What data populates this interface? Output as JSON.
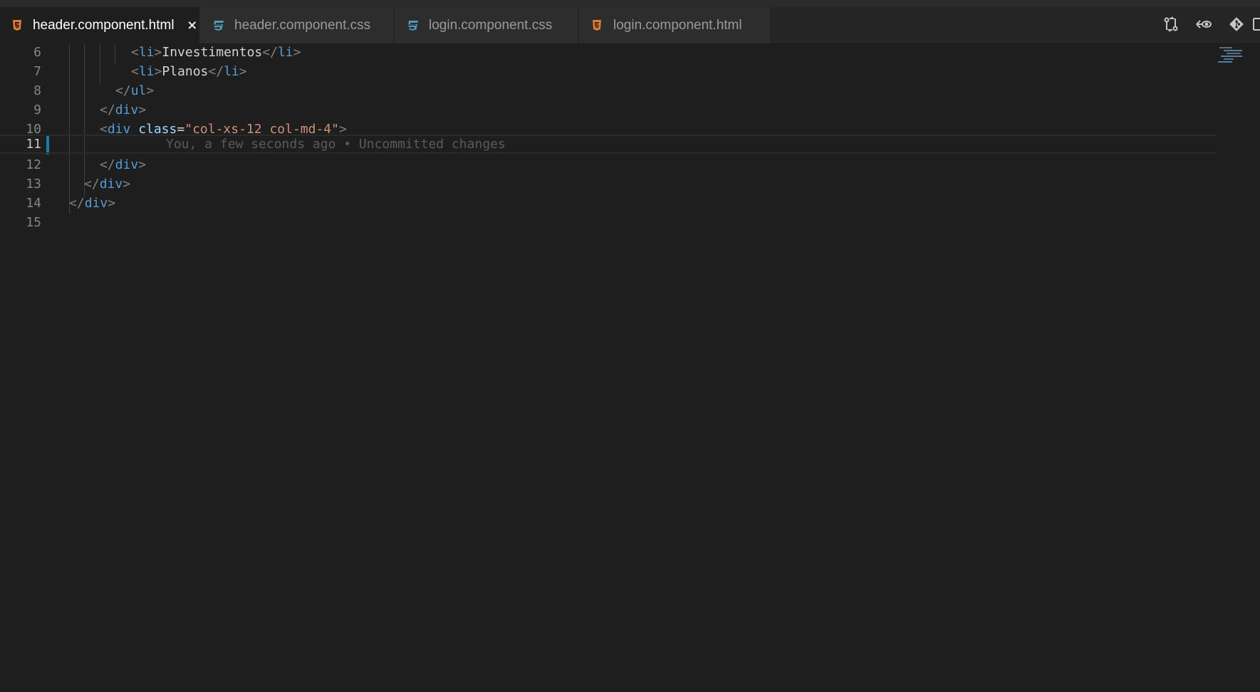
{
  "tabs": [
    {
      "label": "header.component.html",
      "type": "html",
      "active": true,
      "close": "×"
    },
    {
      "label": "header.component.css",
      "type": "css",
      "active": false
    },
    {
      "label": "login.component.css",
      "type": "css",
      "active": false
    },
    {
      "label": "login.component.html",
      "type": "html",
      "active": false
    }
  ],
  "colors": {
    "html_icon": "#e37933",
    "css_icon": "#519aba",
    "modified_marker": "#1a7fa3"
  },
  "actions": [
    {
      "icon": "compare-changes-icon"
    },
    {
      "icon": "open-changes-icon"
    },
    {
      "icon": "git-icon"
    }
  ],
  "editor": {
    "lines": [
      {
        "n": "6"
      },
      {
        "n": "7"
      },
      {
        "n": "8"
      },
      {
        "n": "9"
      },
      {
        "n": "10"
      },
      {
        "n": "11"
      },
      {
        "n": "12"
      },
      {
        "n": "13"
      },
      {
        "n": "14"
      },
      {
        "n": "15"
      }
    ],
    "code": {
      "l6_tag": "li",
      "l6_text": "Investimentos",
      "l6_tag_close": "li",
      "l7_tag": "li",
      "l7_text": "Planos",
      "l7_tag_close": "li",
      "l8_tag": "ul",
      "l9_tag": "div",
      "l10_tag": "div",
      "l10_attr": "class",
      "l10_val": "\"col-xs-12 col-md-4\"",
      "l12_tag": "div",
      "l13_tag": "div",
      "l14_tag": "div"
    },
    "blame": "You, a few seconds ago • Uncommitted changes"
  }
}
